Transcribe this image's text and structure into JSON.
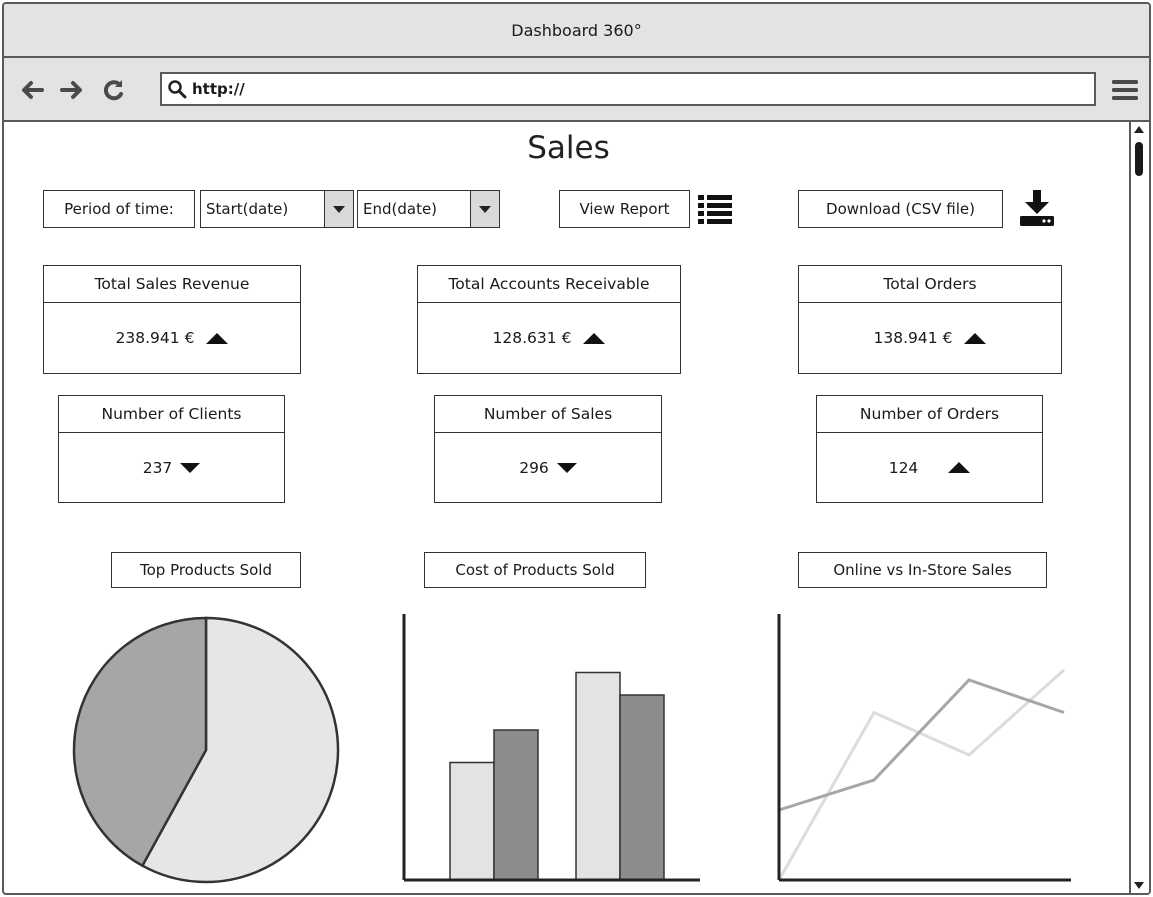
{
  "window": {
    "title": "Dashboard 360°"
  },
  "browser": {
    "url_value": "http://"
  },
  "page": {
    "title": "Sales"
  },
  "filters": {
    "period_label": "Period of time:",
    "start_value": "Start(date)",
    "end_value": "End(date)",
    "view_report_label": "View Report",
    "download_label": "Download (CSV file)"
  },
  "metrics": [
    {
      "label": "Total Sales Revenue",
      "value": "238.941 €",
      "trend": "up"
    },
    {
      "label": "Total Accounts Receivable",
      "value": "128.631 €",
      "trend": "up"
    },
    {
      "label": "Total Orders",
      "value": "138.941 €",
      "trend": "up"
    },
    {
      "label": "Number of Clients",
      "value": "237",
      "trend": "down"
    },
    {
      "label": "Number of Sales",
      "value": "296",
      "trend": "down"
    },
    {
      "label": "Number of Orders",
      "value": "124",
      "trend": "up"
    }
  ],
  "charts": {
    "pie_title": "Top Products Sold",
    "bar_title": "Cost of Products Sold",
    "line_title": "Online vs In-Store Sales"
  },
  "colors": {
    "light": "#e3e3e3",
    "mid": "#a6a6a6",
    "dark": "#8c8c8c",
    "border": "#333333"
  },
  "chart_data": [
    {
      "type": "pie",
      "title": "Top Products Sold",
      "values": [
        58,
        42
      ],
      "colors": [
        "#e6e6e6",
        "#a6a6a6"
      ]
    },
    {
      "type": "bar",
      "title": "Cost of Products Sold",
      "categories": [
        "",
        ""
      ],
      "series": [
        {
          "values": [
            47,
            83
          ],
          "color": "#e3e3e3"
        },
        {
          "values": [
            60,
            74
          ],
          "color": "#8c8c8c"
        }
      ],
      "ylim": [
        0,
        100
      ]
    },
    {
      "type": "line",
      "title": "Online vs In-Store Sales",
      "x": [
        0,
        1,
        2,
        3,
        4
      ],
      "series": [
        {
          "values": [
            0,
            67,
            50,
            84
          ],
          "color": "#dcdcdc"
        },
        {
          "values": [
            28,
            40,
            80,
            67
          ],
          "color": "#a6a6a6"
        }
      ],
      "ylim": [
        0,
        100
      ]
    }
  ]
}
